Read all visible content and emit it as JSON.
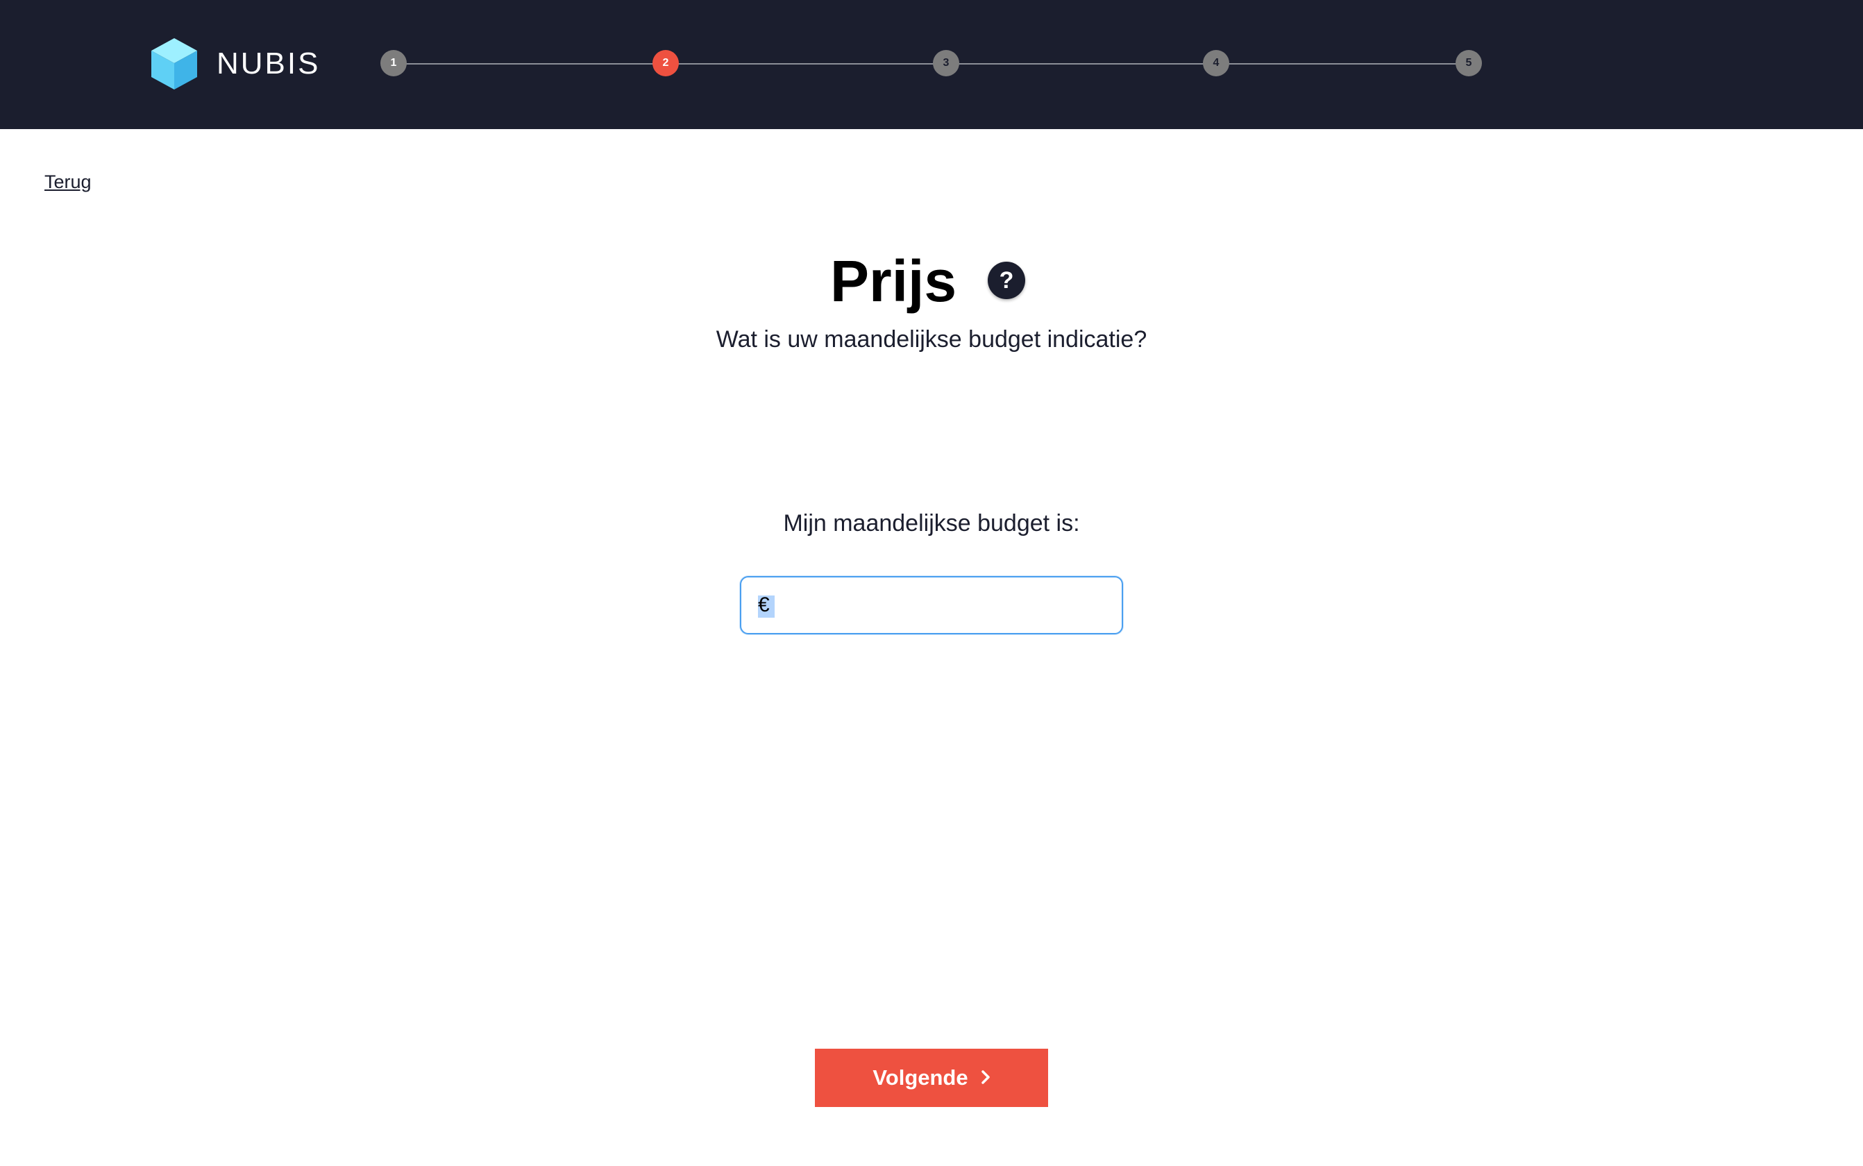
{
  "brand": {
    "name": "NUBIS",
    "logo_icon": "cube-icon"
  },
  "stepper": {
    "steps": [
      "1",
      "2",
      "3",
      "4",
      "5"
    ],
    "active_step": "2"
  },
  "nav": {
    "back_label": "Terug"
  },
  "page": {
    "title": "Prijs",
    "help_glyph": "?",
    "subtitle": "Wat is uw maandelijkse budget indicatie?"
  },
  "budget": {
    "label": "Mijn maandelijkse budget is:",
    "value": "€"
  },
  "actions": {
    "next_label": "Volgende",
    "next_icon": "chevron-right-icon"
  },
  "colors": {
    "header_bg": "#1b1e2e",
    "accent": "#ee5140",
    "focus": "#4a9ff0"
  }
}
